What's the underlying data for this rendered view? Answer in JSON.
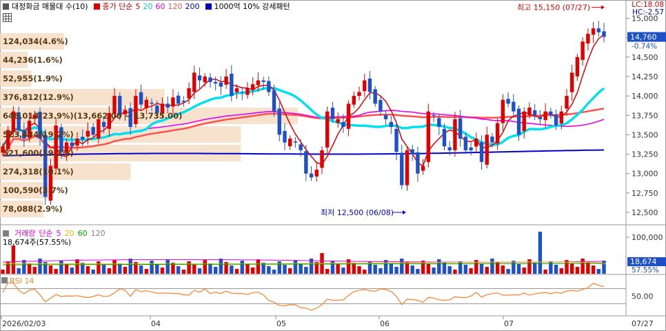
{
  "header": {
    "title": "대정화금 매물대 수(10)",
    "ma_label": "종가 단순",
    "ma_periods": [
      "5",
      "20",
      "60",
      "120",
      "200"
    ],
    "ma_colors": [
      "#e00000",
      "#00c8e6",
      "#e600e6",
      "#ff4f4f",
      "#0000c8"
    ],
    "pattern_label": "1000억 10% 강세패턴",
    "lc_label": "LC:18.08",
    "hc_label": "HC:-2.57"
  },
  "price_panel": {
    "y_ticks": [
      "15,000",
      "14,750",
      "14,500",
      "14,250",
      "14,000",
      "13,750",
      "13,500",
      "13,250",
      "13,000",
      "12,750",
      "12,500"
    ],
    "current_price": "14,760",
    "current_change": "-0.74%",
    "high_annotation": "최고 15,150 (07/27)",
    "low_annotation": "최저 12,500 (06/08)",
    "volume_profile_labels": [
      "124,034(4.6%)",
      "44,236(1.6%)",
      "52,955(1.9%)",
      "376,812(12.9%)",
      "648,013(23.9%)(13,662.00 ~ 13,735.00)",
      "523,434(19.2%)",
      "521,600(19.2%)",
      "274,318(10.1%)",
      "100,590(3.7%)",
      "78,088(2.9%)"
    ]
  },
  "volume_panel": {
    "label": "거래량",
    "ma_label": "단순",
    "ma_periods": [
      "5",
      "20",
      "60",
      "120"
    ],
    "ma_colors": [
      "#e600e6",
      "#e6b800",
      "#00a000",
      "#808080"
    ],
    "reading": "18,674주(57.55%)",
    "y_tick": "100,000",
    "current_volume": "18,674",
    "current_pct": "57.55%"
  },
  "rsi_panel": {
    "label": "RSI 14",
    "y_tick": "50.00"
  },
  "x_axis": {
    "labels": [
      "2026/02/03",
      "04",
      "05",
      "06",
      "07"
    ],
    "right_label": "07/27"
  },
  "chart_data": {
    "type": "candlestick",
    "y_range": [
      12340,
      15200
    ],
    "closes": [
      13350,
      13560,
      13800,
      13560,
      13450,
      13680,
      13760,
      13450,
      12700,
      13100,
      13620,
      13280,
      13400,
      13350,
      13450,
      13440,
      13550,
      13500,
      13700,
      13600,
      13780,
      14000,
      13750,
      13820,
      13600,
      14000,
      13890,
      13950,
      13900,
      13780,
      13900,
      13850,
      13980,
      13900,
      13920,
      14100,
      14300,
      14200,
      14250,
      14180,
      14160,
      14120,
      14250,
      14000,
      14100,
      14050,
      14100,
      14150,
      14200,
      14180,
      14050,
      13800,
      13500,
      13400,
      13450,
      13400,
      13300,
      13000,
      12950,
      13050,
      13300,
      13800,
      13700,
      13700,
      13600,
      13900,
      14000,
      14050,
      14200,
      14050,
      13900,
      13800,
      13700,
      13600,
      13280,
      12850,
      13300,
      13250,
      13000,
      13100,
      13800,
      13750,
      13600,
      13350,
      13300,
      13700,
      13450,
      13300,
      13300,
      13450,
      13150,
      13500,
      13400,
      13650,
      13950,
      13900,
      13800,
      13500,
      13800,
      13850,
      13750,
      13700,
      13800,
      13750,
      13620,
      13800,
      14000,
      14300,
      14500,
      14700,
      14800,
      14870,
      14820,
      14760
    ],
    "rsi_levels": [
      70,
      30
    ],
    "profile_rows": [
      {
        "label": "124,034(4.6%)",
        "pct": 4.6
      },
      {
        "label": "44,236(1.6%)",
        "pct": 1.6
      },
      {
        "label": "52,955(1.9%)",
        "pct": 1.9
      },
      {
        "label": "376,812(12.9%)",
        "pct": 12.9
      },
      {
        "label": "648,013(23.9%)",
        "pct": 23.9
      },
      {
        "label": "523,434(19.2%)",
        "pct": 19.2
      },
      {
        "label": "521,600(19.2%)",
        "pct": 19.2
      },
      {
        "label": "274,318(10.1%)",
        "pct": 10.1
      },
      {
        "label": "100,590(3.7%)",
        "pct": 3.7
      },
      {
        "label": "78,088(2.9%)",
        "pct": 2.9
      }
    ]
  }
}
